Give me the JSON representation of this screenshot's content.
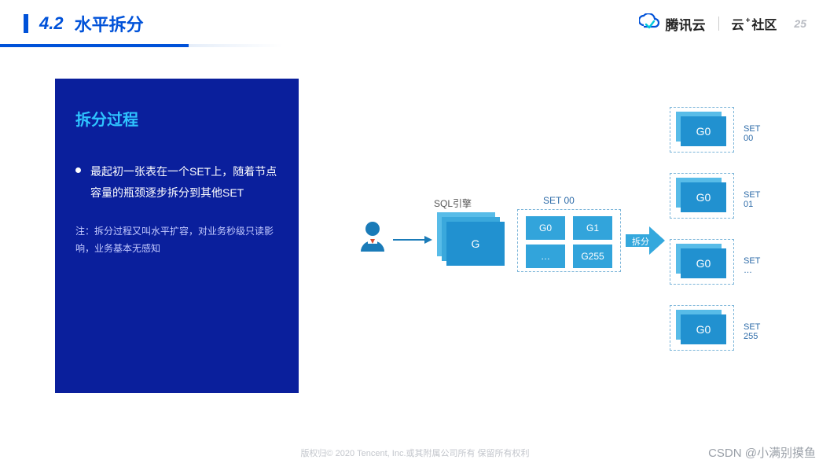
{
  "header": {
    "section_num": "4.2",
    "section_title": "水平拆分",
    "brand_main": "腾讯云",
    "brand_sub_prefix": "云",
    "brand_sub_plus": "+",
    "brand_sub_suffix": "社区",
    "page_num": "25"
  },
  "sidebar": {
    "title": "拆分过程",
    "bullet": "最起初一张表在一个SET上，随着节点容量的瓶颈逐步拆分到其他SET",
    "note": "注：拆分过程又叫水平扩容，对业务秒级只读影响，业务基本无感知"
  },
  "diagram": {
    "sql_engine_label": "SQL引擎",
    "main_card": "G",
    "set00_label": "SET 00",
    "grid": {
      "g0": "G0",
      "g1": "G1",
      "dots": "…",
      "g255": "G255"
    },
    "split_label": "拆分",
    "sets": [
      {
        "card": "G0",
        "label": "SET 00"
      },
      {
        "card": "G0",
        "label": "SET 01"
      },
      {
        "card": "G0",
        "label": "SET …"
      },
      {
        "card": "G0",
        "label": "SET 255"
      }
    ]
  },
  "footer": {
    "copyright": "版权归© 2020 Tencent, Inc.或其附属公司所有 保留所有权利",
    "watermark": "CSDN @小满别摸鱼"
  }
}
